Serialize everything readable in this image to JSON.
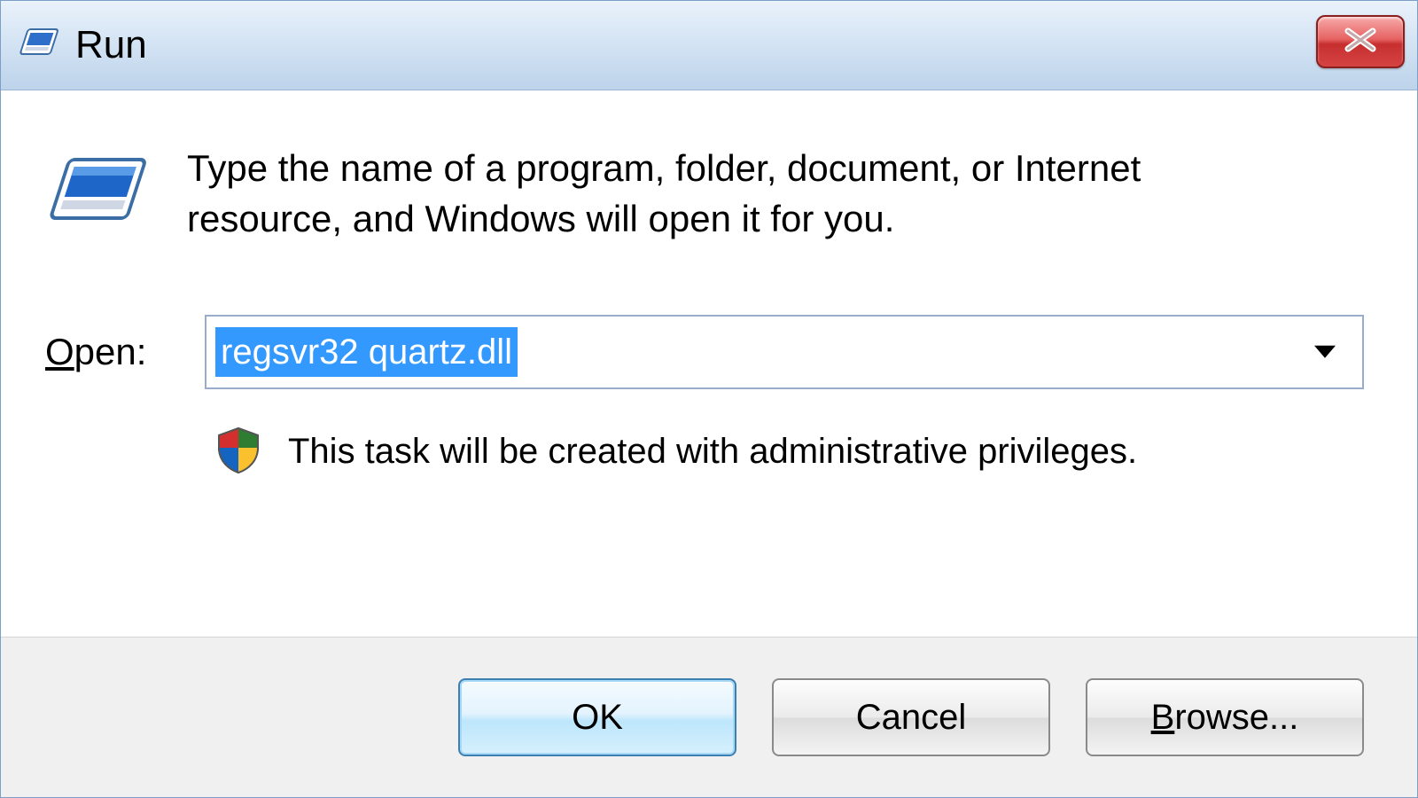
{
  "titlebar": {
    "title": "Run"
  },
  "body": {
    "description": "Type the name of a program, folder, document, or Internet resource, and Windows will open it for you.",
    "open_label_accel": "O",
    "open_label_rest": "pen:",
    "command_value": "regsvr32 quartz.dll",
    "admin_note": "This task will be created with administrative privileges."
  },
  "buttons": {
    "ok": "OK",
    "cancel": "Cancel",
    "browse_accel": "B",
    "browse_rest": "rowse..."
  }
}
